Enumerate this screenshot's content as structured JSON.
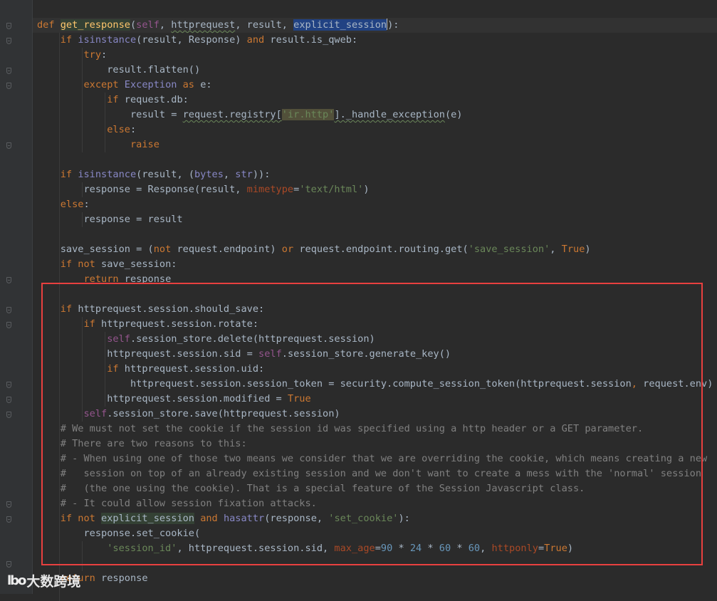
{
  "code_lines": [
    {
      "indent": 0,
      "tokens": [
        {
          "t": "kw",
          "v": "def "
        },
        {
          "t": "fn",
          "v": "get_response",
          "h": "hl-fn"
        },
        {
          "t": "pt",
          "v": "("
        },
        {
          "t": "self",
          "v": "self"
        },
        {
          "t": "pt",
          "v": ", "
        },
        {
          "t": "pt",
          "v": "httprequest",
          "h": "typo"
        },
        {
          "t": "pt",
          "v": ", result, "
        },
        {
          "t": "pt",
          "v": "explicit_session",
          "h": "hl-sel"
        },
        {
          "t": "caret",
          "v": ""
        },
        {
          "t": "pt",
          "v": "):"
        }
      ],
      "current": true
    },
    {
      "indent": 1,
      "tokens": [
        {
          "t": "kw",
          "v": "if "
        },
        {
          "t": "bi",
          "v": "isinstance"
        },
        {
          "t": "pt",
          "v": "(result, Response) "
        },
        {
          "t": "kw",
          "v": "and "
        },
        {
          "t": "pt",
          "v": "result.is_qweb:"
        }
      ]
    },
    {
      "indent": 2,
      "tokens": [
        {
          "t": "kw",
          "v": "try"
        },
        {
          "t": "pt",
          "v": ":"
        }
      ]
    },
    {
      "indent": 3,
      "tokens": [
        {
          "t": "pt",
          "v": "result.flatten()"
        }
      ]
    },
    {
      "indent": 2,
      "tokens": [
        {
          "t": "kw",
          "v": "except "
        },
        {
          "t": "bi",
          "v": "Exception "
        },
        {
          "t": "kw",
          "v": "as "
        },
        {
          "t": "pt",
          "v": "e:"
        }
      ]
    },
    {
      "indent": 3,
      "tokens": [
        {
          "t": "kw",
          "v": "if "
        },
        {
          "t": "pt",
          "v": "request.db:"
        }
      ]
    },
    {
      "indent": 4,
      "tokens": [
        {
          "t": "pt",
          "v": "result = "
        },
        {
          "t": "pt",
          "v": "request.registry[",
          "h": "typo"
        },
        {
          "t": "str",
          "v": "'ir.http'",
          "h": "hl-str"
        },
        {
          "t": "pt",
          "v": "]._handle_exception",
          "h": "typo"
        },
        {
          "t": "pt",
          "v": "(e)"
        }
      ]
    },
    {
      "indent": 3,
      "tokens": [
        {
          "t": "kw",
          "v": "else"
        },
        {
          "t": "pt",
          "v": ":"
        }
      ]
    },
    {
      "indent": 4,
      "tokens": [
        {
          "t": "kw",
          "v": "raise"
        }
      ]
    },
    {
      "indent": 0,
      "tokens": []
    },
    {
      "indent": 1,
      "tokens": [
        {
          "t": "kw",
          "v": "if "
        },
        {
          "t": "bi",
          "v": "isinstance"
        },
        {
          "t": "pt",
          "v": "(result, ("
        },
        {
          "t": "bi",
          "v": "bytes"
        },
        {
          "t": "pt",
          "v": ", "
        },
        {
          "t": "bi",
          "v": "str"
        },
        {
          "t": "pt",
          "v": ")):"
        }
      ]
    },
    {
      "indent": 2,
      "tokens": [
        {
          "t": "pt",
          "v": "response = Response(result, "
        },
        {
          "t": "param",
          "v": "mimetype"
        },
        {
          "t": "pt",
          "v": "="
        },
        {
          "t": "str",
          "v": "'text/html'"
        },
        {
          "t": "pt",
          "v": ")"
        }
      ]
    },
    {
      "indent": 1,
      "tokens": [
        {
          "t": "kw",
          "v": "else"
        },
        {
          "t": "pt",
          "v": ":"
        }
      ]
    },
    {
      "indent": 2,
      "tokens": [
        {
          "t": "pt",
          "v": "response = result"
        }
      ]
    },
    {
      "indent": 0,
      "tokens": []
    },
    {
      "indent": 1,
      "tokens": [
        {
          "t": "pt",
          "v": "save_session = ("
        },
        {
          "t": "kw",
          "v": "not "
        },
        {
          "t": "pt",
          "v": "request.endpoint) "
        },
        {
          "t": "kw",
          "v": "or "
        },
        {
          "t": "pt",
          "v": "request.endpoint.routing.get("
        },
        {
          "t": "str",
          "v": "'save_session'"
        },
        {
          "t": "pt",
          "v": ", "
        },
        {
          "t": "kw",
          "v": "True"
        },
        {
          "t": "pt",
          "v": ")"
        }
      ]
    },
    {
      "indent": 1,
      "tokens": [
        {
          "t": "kw",
          "v": "if not "
        },
        {
          "t": "pt",
          "v": "save_session:"
        }
      ]
    },
    {
      "indent": 2,
      "tokens": [
        {
          "t": "kw",
          "v": "return "
        },
        {
          "t": "pt",
          "v": "response"
        }
      ]
    },
    {
      "indent": 0,
      "tokens": []
    },
    {
      "indent": 1,
      "tokens": [
        {
          "t": "kw",
          "v": "if "
        },
        {
          "t": "pt",
          "v": "httprequest.session.should_save:"
        }
      ]
    },
    {
      "indent": 2,
      "tokens": [
        {
          "t": "kw",
          "v": "if "
        },
        {
          "t": "pt",
          "v": "httprequest.session.rotate:"
        }
      ]
    },
    {
      "indent": 3,
      "tokens": [
        {
          "t": "self",
          "v": "self"
        },
        {
          "t": "pt",
          "v": ".session_store.delete(httprequest.session)"
        }
      ]
    },
    {
      "indent": 3,
      "tokens": [
        {
          "t": "pt",
          "v": "httprequest.session.sid = "
        },
        {
          "t": "self",
          "v": "self"
        },
        {
          "t": "pt",
          "v": ".session_store.generate_key()"
        }
      ]
    },
    {
      "indent": 3,
      "tokens": [
        {
          "t": "kw",
          "v": "if "
        },
        {
          "t": "pt",
          "v": "httprequest.session.uid:"
        }
      ]
    },
    {
      "indent": 4,
      "tokens": [
        {
          "t": "pt",
          "v": "httprequest.session.session_token = security.compute_session_token(httprequest.session"
        },
        {
          "t": "kw",
          "v": ", "
        },
        {
          "t": "pt",
          "v": "request.env)"
        }
      ]
    },
    {
      "indent": 3,
      "tokens": [
        {
          "t": "pt",
          "v": "httprequest.session.modified = "
        },
        {
          "t": "kw",
          "v": "True"
        }
      ]
    },
    {
      "indent": 2,
      "tokens": [
        {
          "t": "self",
          "v": "self"
        },
        {
          "t": "pt",
          "v": ".session_store.save(httprequest.session)"
        }
      ]
    },
    {
      "indent": 1,
      "tokens": [
        {
          "t": "cmt",
          "v": "# We must not set the cookie if the session id was specified using a http header or a GET parameter."
        }
      ]
    },
    {
      "indent": 1,
      "tokens": [
        {
          "t": "cmt",
          "v": "# There are two reasons to this:"
        }
      ]
    },
    {
      "indent": 1,
      "tokens": [
        {
          "t": "cmt",
          "v": "# - When using one of those two means we consider that we are overriding the cookie, which means creating a new"
        }
      ]
    },
    {
      "indent": 1,
      "tokens": [
        {
          "t": "cmt",
          "v": "#   session on top of an already existing session and we don't want to create a mess with the 'normal' session"
        }
      ]
    },
    {
      "indent": 1,
      "tokens": [
        {
          "t": "cmt",
          "v": "#   (the one using the cookie). That is a special feature of the Session Javascript class."
        }
      ]
    },
    {
      "indent": 1,
      "tokens": [
        {
          "t": "cmt",
          "v": "# - It could allow session fixation attacks."
        }
      ]
    },
    {
      "indent": 1,
      "tokens": [
        {
          "t": "kw",
          "v": "if not "
        },
        {
          "t": "pt",
          "v": "explicit_session",
          "h": "hl-usage"
        },
        {
          "t": "pt",
          "v": " "
        },
        {
          "t": "kw",
          "v": "and "
        },
        {
          "t": "bi",
          "v": "hasattr"
        },
        {
          "t": "pt",
          "v": "(response, "
        },
        {
          "t": "str",
          "v": "'set_cookie'"
        },
        {
          "t": "pt",
          "v": "):"
        }
      ]
    },
    {
      "indent": 2,
      "tokens": [
        {
          "t": "pt",
          "v": "response.set_cookie("
        }
      ]
    },
    {
      "indent": 3,
      "tokens": [
        {
          "t": "str",
          "v": "'session_id'"
        },
        {
          "t": "pt",
          "v": ", httprequest.session.sid, "
        },
        {
          "t": "param",
          "v": "max_age"
        },
        {
          "t": "pt",
          "v": "="
        },
        {
          "t": "num",
          "v": "90"
        },
        {
          "t": "pt",
          "v": " * "
        },
        {
          "t": "num",
          "v": "24"
        },
        {
          "t": "pt",
          "v": " * "
        },
        {
          "t": "num",
          "v": "60"
        },
        {
          "t": "pt",
          "v": " * "
        },
        {
          "t": "num",
          "v": "60"
        },
        {
          "t": "pt",
          "v": ", "
        },
        {
          "t": "param",
          "v": "httponly"
        },
        {
          "t": "pt",
          "v": "="
        },
        {
          "t": "kw",
          "v": "True"
        },
        {
          "t": "pt",
          "v": ")"
        }
      ]
    },
    {
      "indent": 0,
      "tokens": []
    },
    {
      "indent": 1,
      "tokens": [
        {
          "t": "kw",
          "v": "return "
        },
        {
          "t": "pt",
          "v": "response"
        }
      ]
    }
  ],
  "watermark": {
    "logo": "lbo",
    "text": "大数跨境"
  },
  "colors": {
    "annotation_box": "#e8403f",
    "editor_bg": "#2b2b2b",
    "gutter_bg": "#313335"
  }
}
